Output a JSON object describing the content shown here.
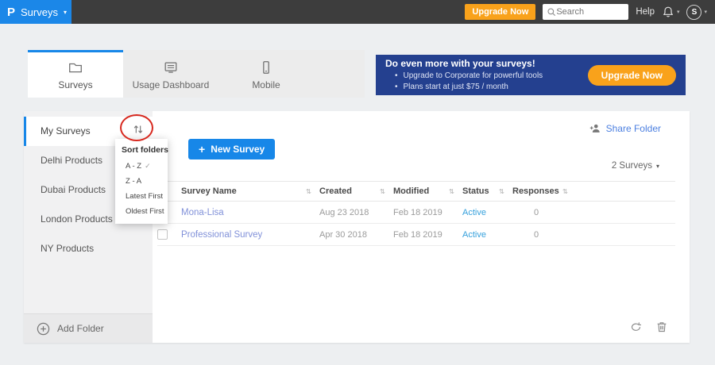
{
  "topbar": {
    "logo": "P",
    "product_menu": "Surveys",
    "caret": "▾",
    "upgrade_button": "Upgrade Now",
    "search_placeholder": "Search",
    "help": "Help",
    "avatar_initial": "S"
  },
  "tabs": [
    {
      "label": "Surveys",
      "active": true
    },
    {
      "label": "Usage Dashboard",
      "active": false
    },
    {
      "label": "Mobile",
      "active": false
    }
  ],
  "banner": {
    "title": "Do even more with your surveys!",
    "bullets": [
      "Upgrade to Corporate for powerful tools",
      "Plans start at just $75 / month"
    ],
    "cta": "Upgrade Now"
  },
  "sidebar": {
    "folders": [
      {
        "label": "My Surveys",
        "active": true
      },
      {
        "label": "Delhi Products",
        "active": false
      },
      {
        "label": "Dubai Products",
        "active": false
      },
      {
        "label": "London Products",
        "active": false
      },
      {
        "label": "NY Products",
        "active": false
      }
    ],
    "add_folder": "Add Folder"
  },
  "sort_menu": {
    "title": "Sort folders",
    "options": [
      {
        "label": "A - Z",
        "selected": true,
        "check": "✓"
      },
      {
        "label": "Z - A",
        "selected": false
      },
      {
        "label": "Latest First",
        "selected": false
      },
      {
        "label": "Oldest First",
        "selected": false
      }
    ]
  },
  "toolbar": {
    "new_survey_plus": "+",
    "new_survey": "New Survey",
    "share_folder": "Share Folder",
    "survey_count": "2 Surveys",
    "count_caret": "▾"
  },
  "table": {
    "sort_glyph": "⇅",
    "columns": [
      {
        "label": "Survey Name"
      },
      {
        "label": "Created"
      },
      {
        "label": "Modified"
      },
      {
        "label": "Status"
      },
      {
        "label": "Responses"
      }
    ],
    "rows": [
      {
        "name": "Mona-Lisa",
        "created": "Aug 23 2018",
        "modified": "Feb 18 2019",
        "status": "Active",
        "responses": "0"
      },
      {
        "name": "Professional Survey",
        "created": "Apr 30 2018",
        "modified": "Feb 18 2019",
        "status": "Active",
        "responses": "0"
      }
    ]
  },
  "colors": {
    "brand_blue": "#1b87e8",
    "topbar_bg": "#3d3d3d",
    "banner_navy": "#24408f",
    "orange": "#f9a21b",
    "link_blue": "#4b7fe0",
    "survey_name_blue": "#8191d9",
    "status_active_blue": "#35a0dc",
    "annotation_red": "#d7281e"
  }
}
